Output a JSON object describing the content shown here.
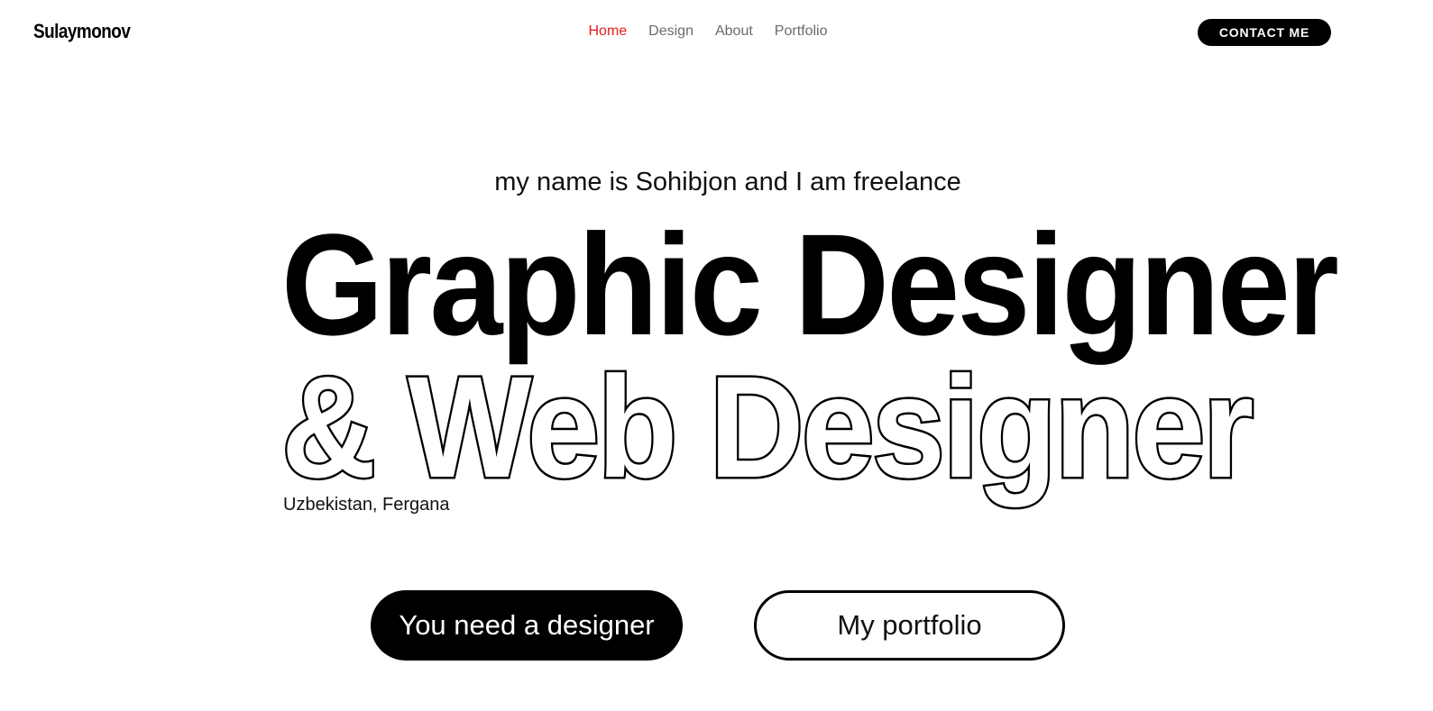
{
  "header": {
    "logo": "Sulaymonov",
    "nav": {
      "home": "Home",
      "design": "Design",
      "about": "About",
      "portfolio": "Portfolio"
    },
    "contact_label": "CONTACT ME",
    "active_color": "#e11d1d"
  },
  "hero": {
    "intro": "my name is Sohibjon and I am freelance",
    "headline_1": "Graphic Designer",
    "headline_2": "& Web Designer",
    "location": "Uzbekistan, Fergana",
    "primary_button": "You need a designer",
    "secondary_button": "My portfolio"
  }
}
